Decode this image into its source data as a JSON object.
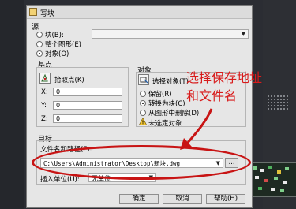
{
  "dialog": {
    "title": "写块",
    "source": {
      "label": "源",
      "options": [
        "块(B):",
        "整个图形(E)",
        "对象(O)"
      ]
    },
    "base_point": {
      "label": "基点",
      "pick_button": "拾取点(K)",
      "x_label": "X:",
      "x_value": "0",
      "y_label": "Y:",
      "y_value": "0",
      "z_label": "Z:",
      "z_value": "0"
    },
    "objects": {
      "label": "对象",
      "select_button": "选择对象(T)",
      "options": [
        "保留(R)",
        "转换为块(C)",
        "从图形中删除(D)"
      ],
      "warning": "未选定对象"
    },
    "target": {
      "label": "目标",
      "file_label": "文件名和路径(F):",
      "file_path": "C:\\Users\\Administrator\\Desktop\\新块.dwg",
      "browse": "...",
      "unit_label": "插入单位(U):",
      "unit_value": "无单位"
    },
    "buttons": {
      "ok": "确定",
      "cancel": "取消",
      "help": "帮助(H)"
    }
  },
  "annotation": {
    "line1": "选择保存地址",
    "line2": "和文件名",
    "color": "#d81b1b"
  },
  "colors": {
    "dialog_bg": "#e6e6e6",
    "desktop_bg": "#2b2d33",
    "highlight": "#c81414"
  }
}
